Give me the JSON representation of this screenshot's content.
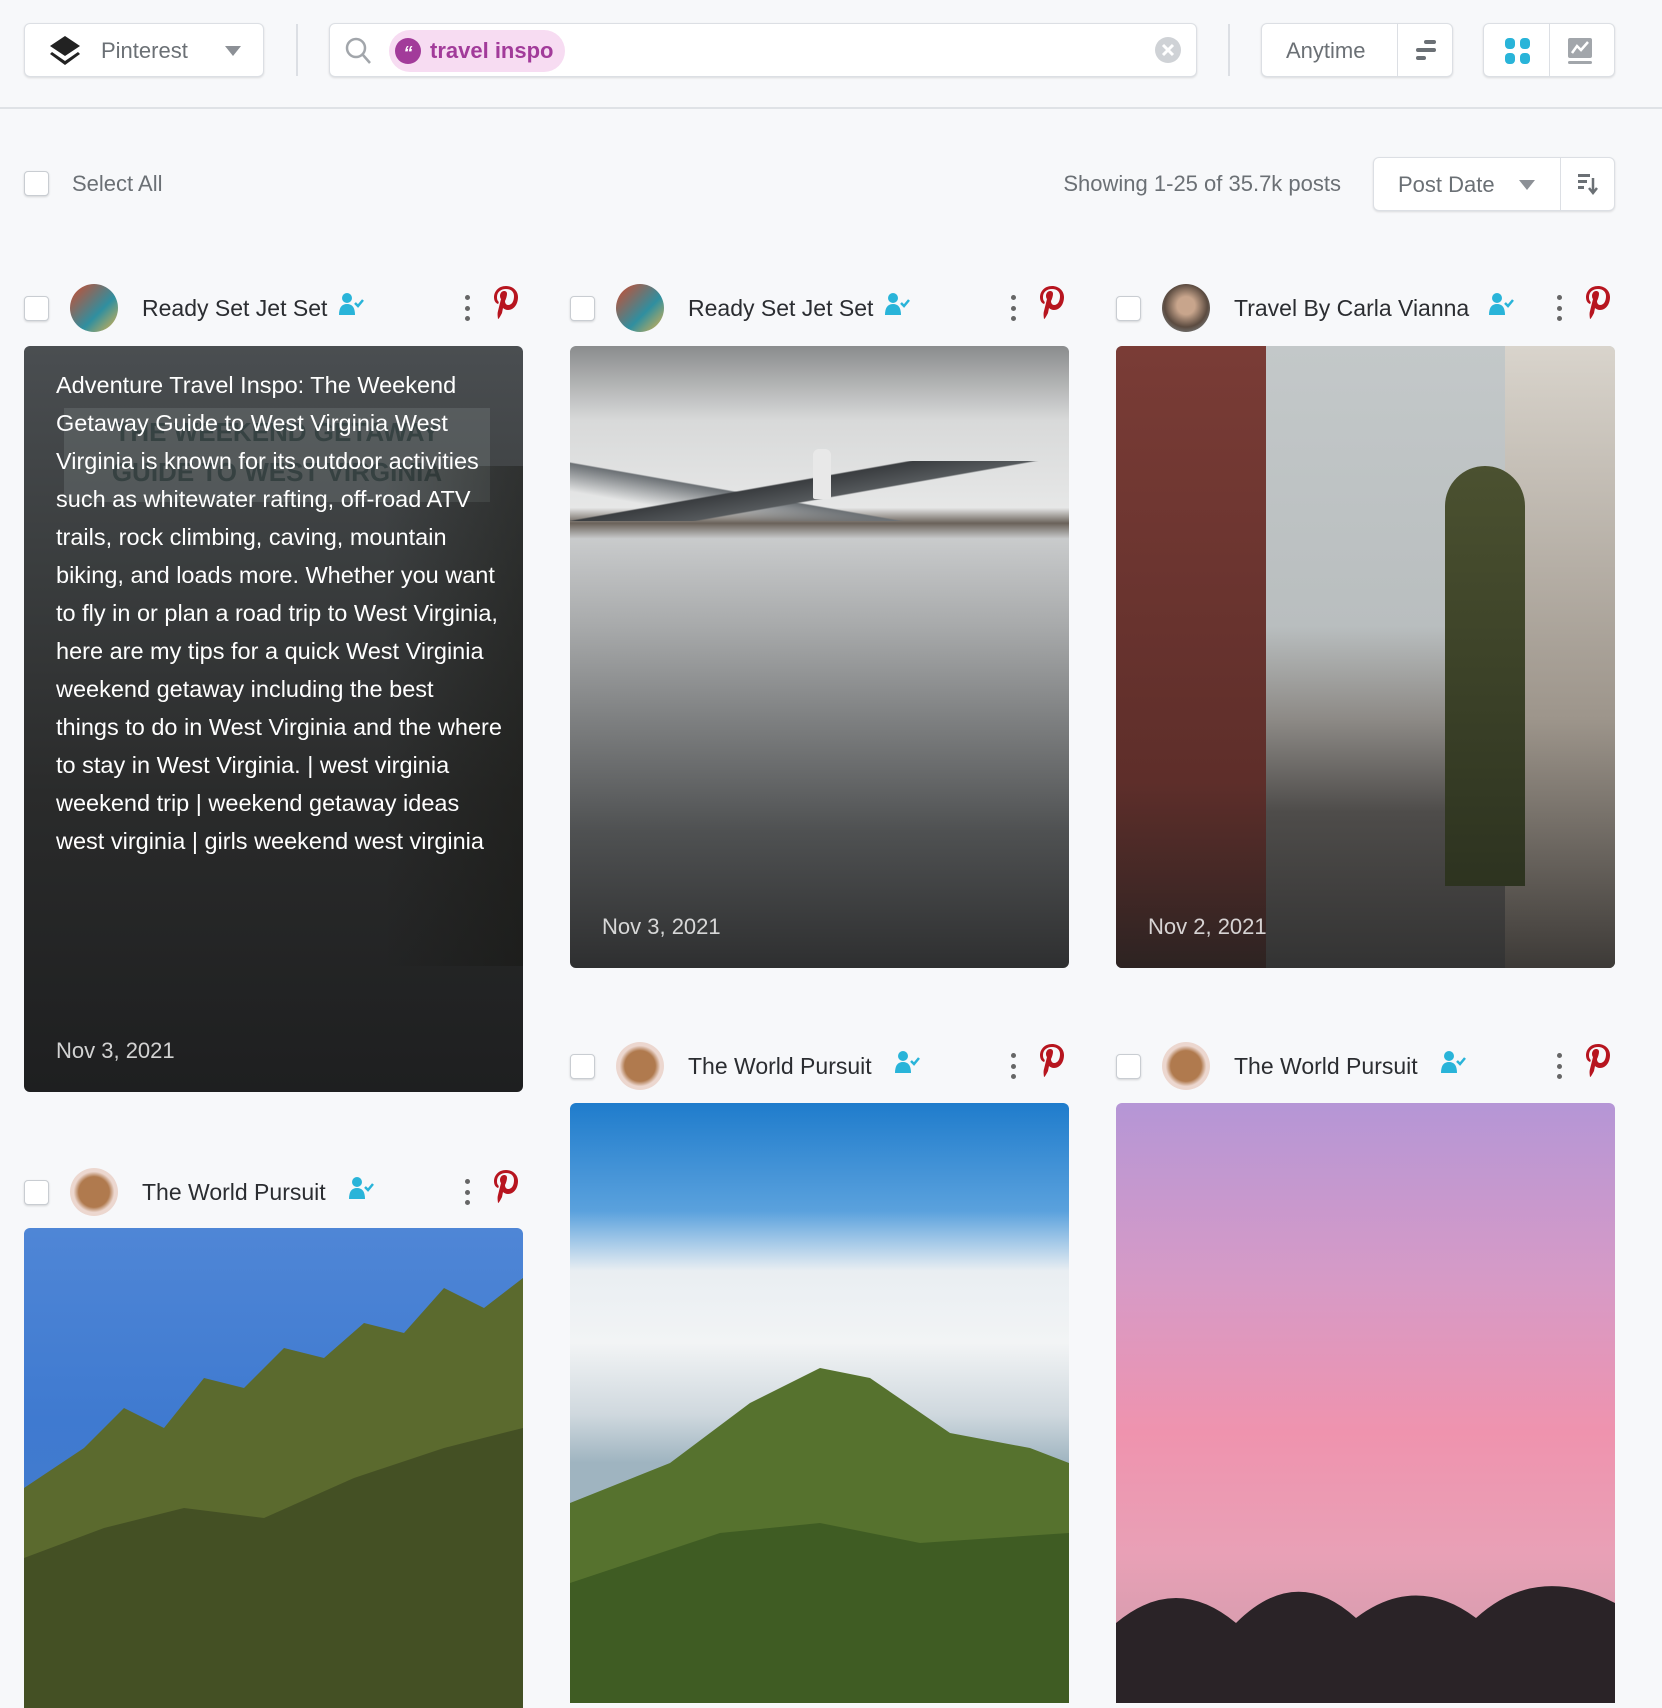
{
  "header": {
    "network": {
      "label": "Pinterest",
      "icon": "layers-icon"
    },
    "search": {
      "chip_label": "travel inspo",
      "chip_color": "#a23b9a",
      "chip_bg": "#f7dcf2"
    },
    "time_filter": {
      "label": "Anytime"
    },
    "view": {
      "active": "grid",
      "accent": "#29b4d9"
    }
  },
  "toolbar": {
    "select_all_label": "Select All",
    "showing_text": "Showing 1-25 of 35.7k posts",
    "sort_label": "Post Date"
  },
  "posts": [
    {
      "author": "Ready Set Jet Set",
      "date": "Nov 3, 2021",
      "text": "Adventure Travel Inspo: The Weekend Getaway Guide to West Virginia West Virginia is known for its outdoor activities such as whitewater rafting, off-road ATV trails, rock climbing, caving, mountain biking, and loads more. Whether you want to fly in or plan a road trip to West Virginia, here are my tips for a quick West Virginia weekend getaway including the best things to do in West Virginia and the where to stay in West Virginia. | west virginia weekend trip | weekend getaway ideas west virginia | girls weekend west virginia",
      "image_text": "THE WEEKEND GETAWAY GUIDE TO WEST VIRGINIA"
    },
    {
      "author": "Ready Set Jet Set",
      "date": "Nov 3, 2021"
    },
    {
      "author": "Travel By Carla Vianna",
      "date": "Nov 2, 2021"
    },
    {
      "author": "The World Pursuit"
    },
    {
      "author": "The World Pursuit"
    },
    {
      "author": "The World Pursuit"
    }
  ],
  "colors": {
    "pinterest": "#b7151f",
    "follow": "#29b4d9"
  }
}
